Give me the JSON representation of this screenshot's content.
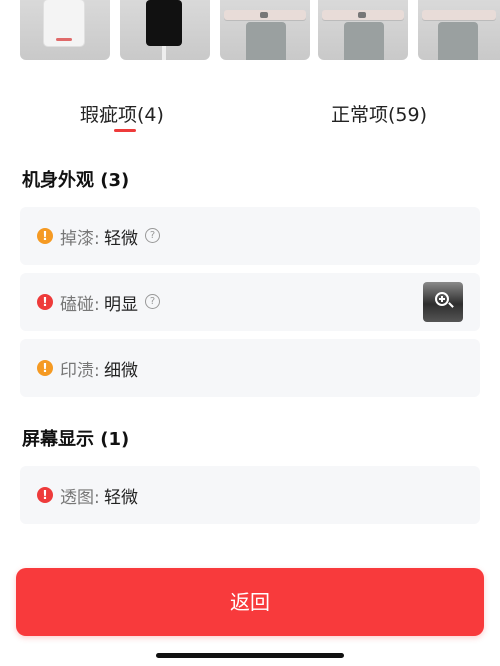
{
  "tabs": [
    {
      "label": "瑕疵项(4)",
      "active": true
    },
    {
      "label": "正常项(59)",
      "active": false
    }
  ],
  "sections": [
    {
      "title": "机身外观 (3)",
      "items": [
        {
          "label": "掉漆:",
          "value": "轻微",
          "severity": "warning",
          "has_help": true
        },
        {
          "label": "磕碰:",
          "value": "明显",
          "severity": "error",
          "has_help": true,
          "has_image": true
        },
        {
          "label": "印渍:",
          "value": "细微",
          "severity": "warning",
          "has_help": false
        }
      ]
    },
    {
      "title": "屏幕显示 (1)",
      "items": [
        {
          "label": "透图:",
          "value": "轻微",
          "severity": "error",
          "has_help": false
        }
      ]
    }
  ],
  "icons": {
    "warning_glyph": "!",
    "error_glyph": "!",
    "help_glyph": "?"
  },
  "colors": {
    "accent": "#f83a3c",
    "warning": "#f59a23",
    "error": "#ee3b3b",
    "card_bg": "#f6f7f9"
  },
  "footer": {
    "return_label": "返回"
  }
}
